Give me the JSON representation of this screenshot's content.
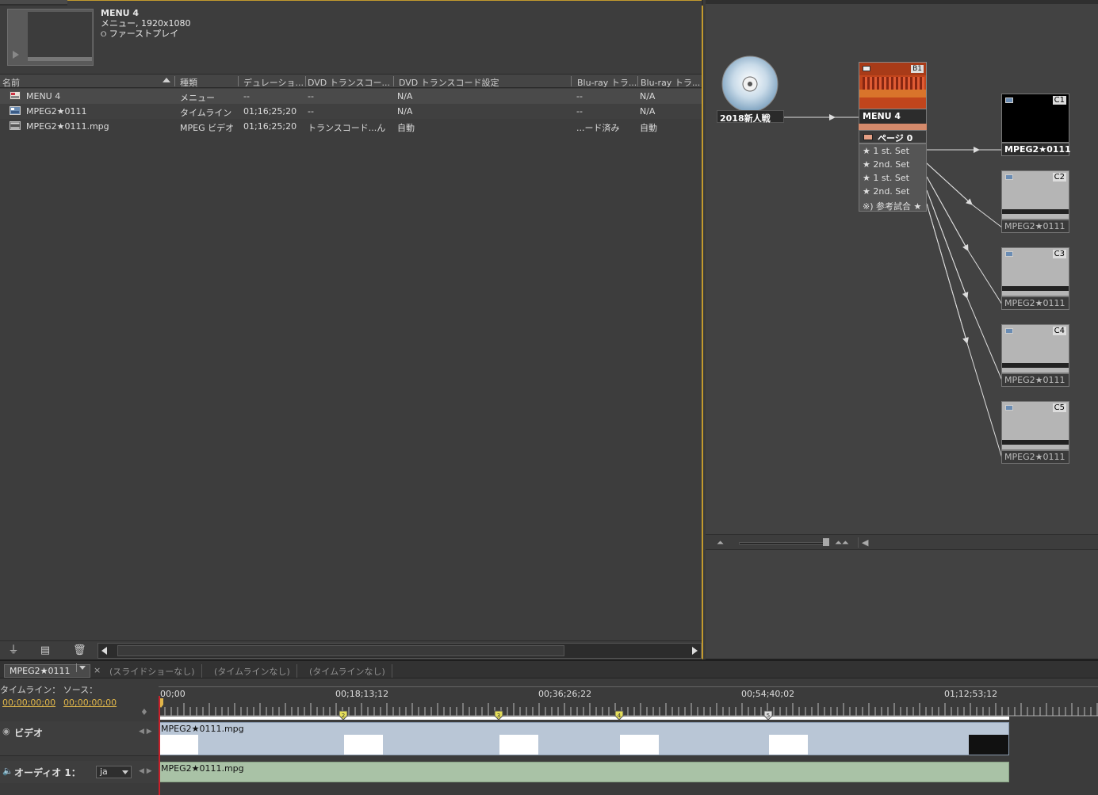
{
  "project": {
    "preview": {
      "title": "MENU 4",
      "subtitle": "メニュー, 1920x1080",
      "first_play": "ファーストプレイ"
    },
    "columns": [
      "名前",
      "種類",
      "デュレーショ...",
      "DVD トランスコー...",
      "DVD トランスコード設定",
      "Blu-ray トラ...",
      "Blu-ray トラ..."
    ],
    "rows": [
      {
        "name": "MENU 4",
        "type": "メニュー",
        "duration": "--",
        "dvd_transcode": "--",
        "dvd_settings": "N/A",
        "bluray1": "--",
        "bluray2": "N/A",
        "icon": "menu-icon"
      },
      {
        "name": "MPEG2★0111",
        "type": "タイムライン",
        "duration": "01;16;25;20",
        "dvd_transcode": "--",
        "dvd_settings": "N/A",
        "bluray1": "--",
        "bluray2": "N/A",
        "icon": "timeline-icon"
      },
      {
        "name": "MPEG2★0111.mpg",
        "type": "MPEG ビデオ",
        "duration": "01;16;25;20",
        "dvd_transcode": "トランスコード...ん",
        "dvd_settings": "自動",
        "bluray1": "...ード済み",
        "bluray2": "自動",
        "icon": "film-icon"
      }
    ]
  },
  "flowchart": {
    "disc_label": "2018新人戦",
    "menu": {
      "title": "MENU 4",
      "badge": "B1",
      "page": "ページ 0",
      "buttons": [
        "★ 1 st. Set",
        "★ 2nd. Set",
        "★ 1 st. Set",
        "★ 2nd. Set",
        "※) 参考試合 ★"
      ]
    },
    "timelines": [
      {
        "label": "MPEG2★0111",
        "badge": "C1"
      },
      {
        "label": "MPEG2★0111",
        "badge": "C2"
      },
      {
        "label": "MPEG2★0111",
        "badge": "C3"
      },
      {
        "label": "MPEG2★0111",
        "badge": "C4"
      },
      {
        "label": "MPEG2★0111",
        "badge": "C5"
      }
    ]
  },
  "timeline": {
    "tabs": {
      "active": "MPEG2★0111",
      "others": [
        "(スライドショーなし)",
        "(タイムラインなし)",
        "(タイムラインなし)"
      ]
    },
    "labels": {
      "timeline": "タイムライン：",
      "source": "ソース："
    },
    "timecode_timeline": "00;00;00;00",
    "timecode_source": "00;00;00;00",
    "ruler": [
      "00;00",
      "00;18;13;12",
      "00;36;26;22",
      "00;54;40;02",
      "01;12;53;12"
    ],
    "chapter_markers": [
      "2",
      "3",
      "4",
      "5"
    ],
    "video_track": {
      "name": "ビデオ",
      "clip": "MPEG2★0111.mpg"
    },
    "audio_track": {
      "name": "オーディオ 1：",
      "lang": "ja",
      "clip": "MPEG2★0111.mpg"
    }
  },
  "colors": {
    "accent": "#c39a2e",
    "playhead": "#c8202a",
    "video_clip": "#b9c6d6",
    "audio_clip": "#a9c2a6",
    "timecode": "#e0b64a"
  }
}
